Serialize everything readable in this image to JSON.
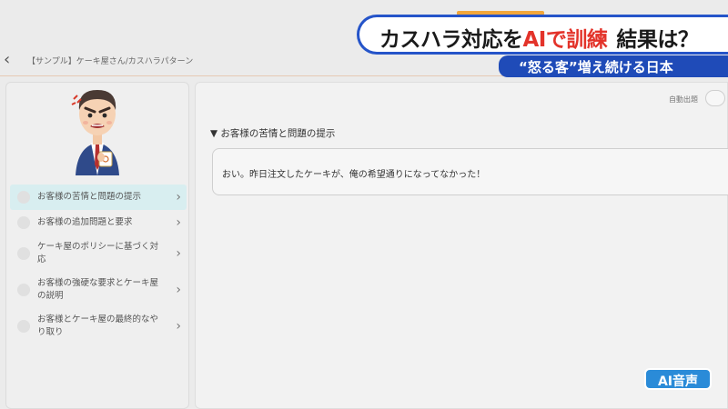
{
  "header": {
    "breadcrumb": "【サンプル】ケーキ屋さん/カスハラパターン"
  },
  "sidebar": {
    "steps": [
      {
        "label": "お客様の苦情と問題の提示",
        "active": true
      },
      {
        "label": "お客様の追加問題と要求",
        "active": false
      },
      {
        "label": "ケーキ屋のポリシーに基づく対応",
        "active": false
      },
      {
        "label": "お客様の強硬な要求とケーキ屋の説明",
        "active": false
      },
      {
        "label": "お客様とケーキ屋の最終的なやり取り",
        "active": false
      }
    ]
  },
  "main": {
    "auto_label": "自動出題",
    "section_title": "▼ お客様の苦情と問題の提示",
    "message": "おい。昨日注文したケーキが、俺の希望通りになってなかった！"
  },
  "overlay": {
    "headline_part1": "カスハラ対応を",
    "headline_accent": "AIで訓練",
    "headline_part2": "結果は？",
    "subheadline": "“怒る客”増え続ける日本",
    "badge": "AI音声"
  },
  "colors": {
    "headline_border": "#2554c9",
    "accent_red": "#e3332a",
    "subhead_bg": "#1f4bb8",
    "badge_bg": "#2a8bd8",
    "active_step_bg": "#d8eef0",
    "orange_bar": "#f2a63b"
  },
  "icons": {
    "back": "chevron-left-icon",
    "step_chevron": "chevron-right-icon",
    "avatar": "angry-customer-avatar"
  }
}
